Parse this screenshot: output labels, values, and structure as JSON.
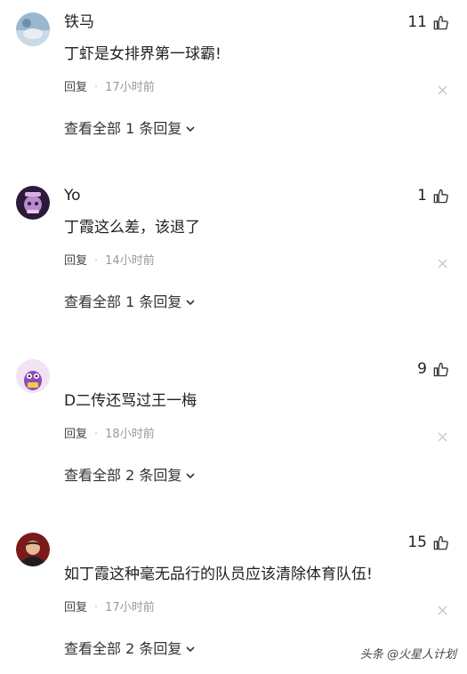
{
  "comments": [
    {
      "username": "铁马",
      "likes": "11",
      "text": "丁虾是女排界第一球霸!",
      "reply_label": "回复",
      "separator": "·",
      "time": "17小时前",
      "view_replies": "查看全部 1 条回复"
    },
    {
      "username": "Yo",
      "likes": "1",
      "text": "丁霞这么差，该退了",
      "reply_label": "回复",
      "separator": "·",
      "time": "14小时前",
      "view_replies": "查看全部 1 条回复"
    },
    {
      "username": "",
      "likes": "9",
      "text": "D二传还骂过王一梅",
      "reply_label": "回复",
      "separator": "·",
      "time": "18小时前",
      "view_replies": "查看全部 2 条回复"
    },
    {
      "username": "",
      "likes": "15",
      "text": "如丁霞这种毫无品行的队员应该清除体育队伍!",
      "reply_label": "回复",
      "separator": "·",
      "time": "17小时前",
      "view_replies": "查看全部 2 条回复"
    }
  ],
  "icons": {
    "like": "thumbs-up-icon",
    "close": "close-icon",
    "chevron": "chevron-down-icon"
  },
  "watermark": "头条 @火星人计划"
}
